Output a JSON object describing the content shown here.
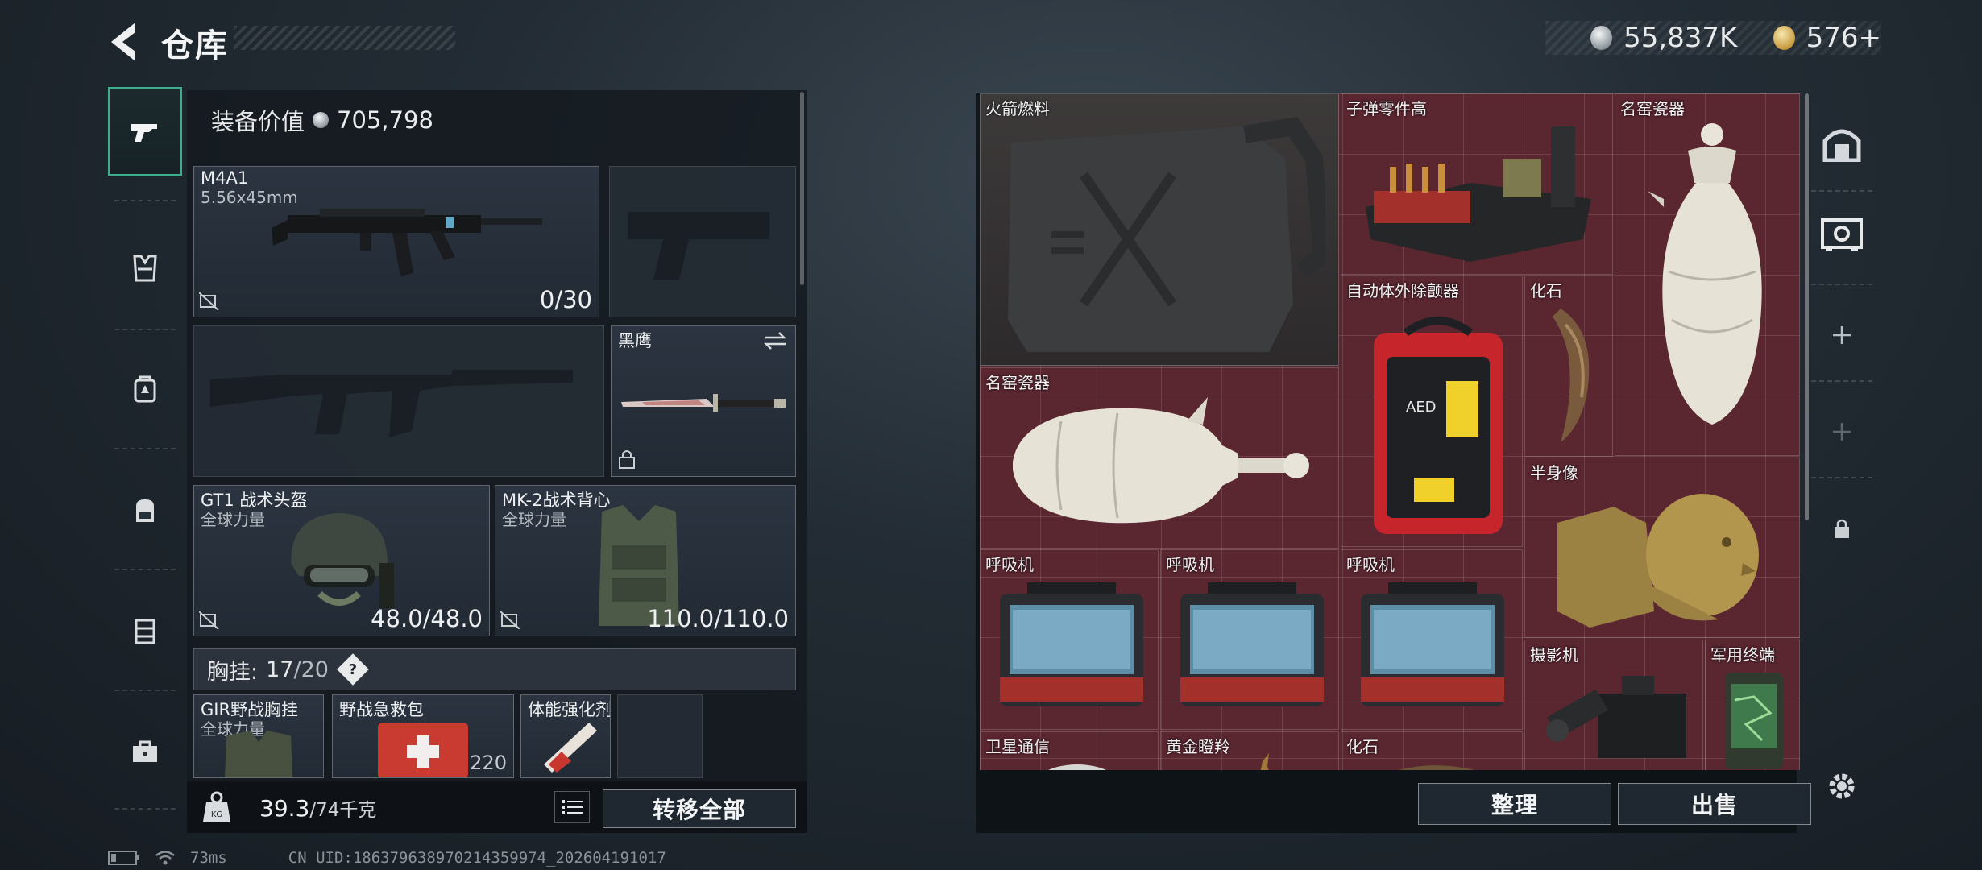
{
  "header": {
    "title": "仓库",
    "currencies": [
      {
        "name": "silver-coin",
        "value": "55,837K"
      },
      {
        "name": "gold-coin",
        "value": "576+"
      }
    ]
  },
  "sidebar": {
    "items": [
      {
        "icon": "pistol-icon",
        "active": true
      },
      {
        "icon": "vest-icon"
      },
      {
        "icon": "backpack-small-icon"
      },
      {
        "icon": "backpack-icon"
      },
      {
        "icon": "container-icon"
      },
      {
        "icon": "toolbox-icon"
      }
    ]
  },
  "equipment": {
    "value_label": "装备价值",
    "value": "705,798",
    "primary_weapon": {
      "name": "M4A1",
      "ammo_type": "5.56x45mm",
      "ammo": "0/30"
    },
    "melee": {
      "name": "黑鹰"
    },
    "helmet": {
      "name": "GT1 战术头盔",
      "faction": "全球力量",
      "durability": "48.0/48.0"
    },
    "armor": {
      "name": "MK-2战术背心",
      "faction": "全球力量",
      "durability": "110.0/110.0"
    },
    "chest_rig": {
      "label": "胸挂:",
      "used": "17",
      "total": "/20"
    },
    "rig_items": [
      {
        "name": "GIR野战胸挂",
        "sub": "全球力量"
      },
      {
        "name": "野战急救包",
        "count": "220"
      },
      {
        "name": "体能强化剂"
      }
    ],
    "weight": {
      "current": "39.3",
      "max": "/74千克"
    },
    "transfer_all": "转移全部"
  },
  "storage": {
    "items": [
      {
        "name": "火箭燃料"
      },
      {
        "name": "子弹零件高"
      },
      {
        "name": "名窑瓷器"
      },
      {
        "name": "自动体外除颤器"
      },
      {
        "name": "化石"
      },
      {
        "name": "名窑瓷器"
      },
      {
        "name": "半身像"
      },
      {
        "name": "呼吸机"
      },
      {
        "name": "呼吸机"
      },
      {
        "name": "呼吸机"
      },
      {
        "name": "摄影机"
      },
      {
        "name": "军用终端"
      },
      {
        "name": "卫星通信"
      },
      {
        "name": "黄金瞪羚"
      },
      {
        "name": "化石"
      }
    ],
    "sort_button": "整理",
    "sell_button": "出售"
  },
  "status": {
    "ping": "73ms",
    "uid": "CN UID:18637963897021435997­4_202604191017"
  }
}
